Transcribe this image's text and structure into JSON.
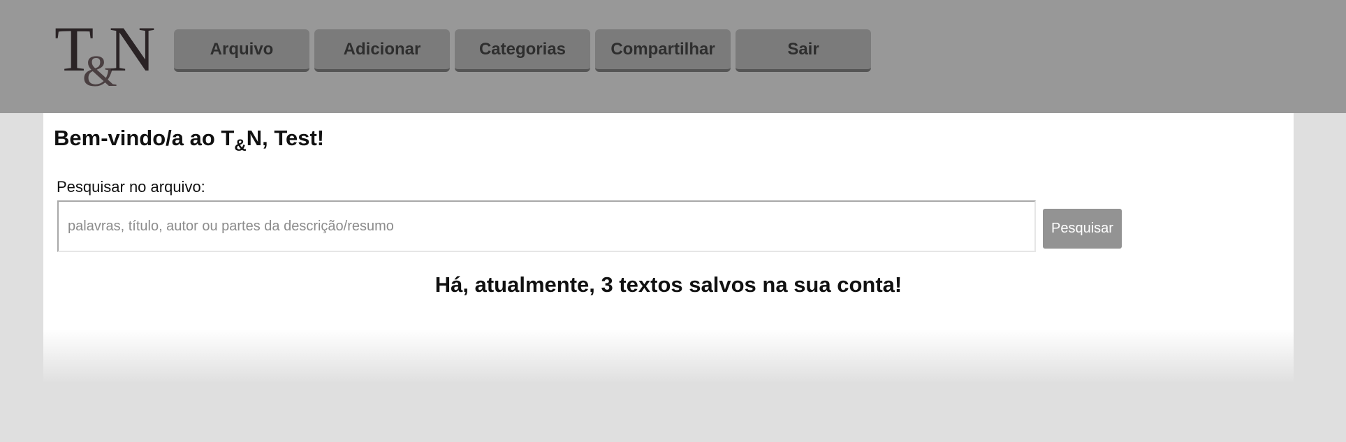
{
  "logo": {
    "t": "T",
    "amp": "&",
    "n": "N"
  },
  "nav": {
    "items": [
      {
        "label": "Arquivo"
      },
      {
        "label": "Adicionar"
      },
      {
        "label": "Categorias"
      },
      {
        "label": "Compartilhar"
      },
      {
        "label": "Sair"
      }
    ]
  },
  "main": {
    "welcome_prefix": "Bem-vindo/a ao T",
    "welcome_amp": "&",
    "welcome_suffix": "N, Test!",
    "search_label": "Pesquisar no arquivo:",
    "search_placeholder": "palavras, título, autor ou partes da descrição/resumo",
    "search_value": "",
    "search_button": "Pesquisar",
    "count_message": "Há, atualmente, 3 textos salvos na sua conta!"
  },
  "colors": {
    "header_bg": "#989898",
    "nav_button_bg": "#7b7b7b",
    "page_bg": "#dfdfdf",
    "content_bg": "#ffffff",
    "search_button_bg": "#939393"
  }
}
